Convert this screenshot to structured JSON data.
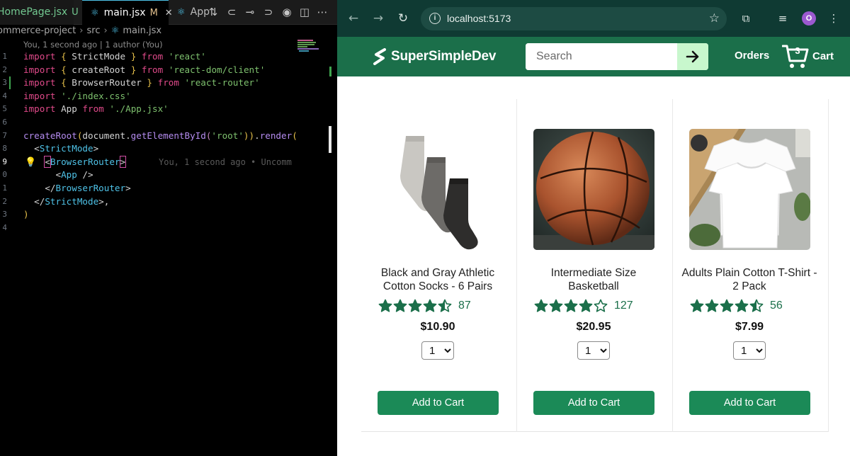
{
  "editor": {
    "tabs": [
      {
        "label": "HomePage.jsx",
        "status": "U"
      },
      {
        "label": "main.jsx",
        "status": "M"
      },
      {
        "label": "App"
      }
    ],
    "breadcrumb": [
      "ommerce-project",
      "src",
      "main.jsx"
    ],
    "blame_header": "You, 1 second ago | 1 author (You)",
    "inline_blame": "You, 1 second ago • Uncomm",
    "line_numbers": [
      "1",
      "2",
      "3",
      "4",
      "5",
      "6",
      "7",
      "8",
      "9",
      "0",
      "1",
      "2",
      "3",
      "4"
    ],
    "code": {
      "l1": {
        "kw1": "import",
        "b1": "{",
        "id": " StrictMode ",
        "b2": "}",
        "kw2": "from",
        "str": "'react'"
      },
      "l2": {
        "kw1": "import",
        "b1": "{",
        "id": " createRoot ",
        "b2": "}",
        "kw2": "from",
        "str": "'react-dom/client'"
      },
      "l3": {
        "kw1": "import",
        "b1": "{",
        "id": " BrowserRouter ",
        "b2": "}",
        "kw2": "from",
        "str": "'react-router'"
      },
      "l4": {
        "kw1": "import",
        "str": "'./index.css'"
      },
      "l5": {
        "kw1": "import",
        "id": " App ",
        "kw2": "from",
        "str": "'./App.jsx'"
      },
      "l7": {
        "fn": "createRoot",
        "p1": "(",
        "obj": "document.",
        "fn2": "getElementById",
        "p2": "(",
        "str": "'root'",
        "p3": "))",
        "dot": ".",
        "fn3": "render",
        "p4": "("
      },
      "l8": {
        "lt": "<",
        "tag": "StrictMode",
        "gt": ">"
      },
      "l9": {
        "lt": "<",
        "tag": "BrowserRouter",
        "gt": ">"
      },
      "l10": {
        "lt": "<",
        "tag": "App",
        "end": " />"
      },
      "l11": {
        "lt": "</",
        "tag": "BrowserRouter",
        "gt": ">"
      },
      "l12": {
        "lt": "</",
        "tag": "StrictMode",
        "gt": ">",
        "comma": ","
      },
      "l13": {
        "p": ")"
      }
    }
  },
  "browser": {
    "url": "localhost:5173",
    "profile_initial": "O",
    "site": {
      "brand": "SuperSimpleDev",
      "search_placeholder": "Search",
      "orders_label": "Orders",
      "cart_label": "Cart",
      "cart_count": "3"
    },
    "products": [
      {
        "name": "Black and Gray Athletic Cotton Socks - 6 Pairs",
        "rating": 4.5,
        "rating_count": "87",
        "price": "$10.90",
        "quantity": "1",
        "button": "Add to Cart"
      },
      {
        "name": "Intermediate Size Basketball",
        "rating": 4.0,
        "rating_count": "127",
        "price": "$20.95",
        "quantity": "1",
        "button": "Add to Cart"
      },
      {
        "name": "Adults Plain Cotton T-Shirt - 2 Pack",
        "rating": 4.5,
        "rating_count": "56",
        "price": "$7.99",
        "quantity": "1",
        "button": "Add to Cart"
      }
    ],
    "colors": {
      "header": "#1b6f4a",
      "button": "#1b8a57",
      "star": "#1b6f4a",
      "search_button": "#c8f7cd"
    }
  }
}
